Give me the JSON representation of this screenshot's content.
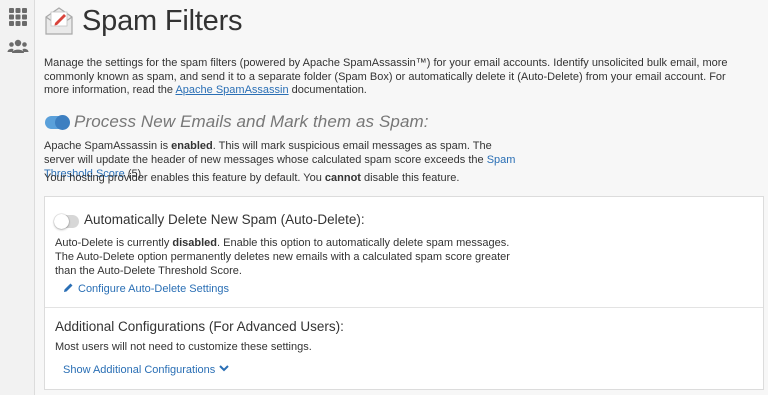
{
  "page": {
    "title": "Spam Filters"
  },
  "intro": {
    "text_before": "Manage the settings for the spam filters (powered by Apache SpamAssassin™) for your email accounts. Identify unsolicited bulk email, more commonly known as spam, and send it to a separate folder (Spam Box) or automatically delete it (Auto-Delete) from your email account. For more information, read the ",
    "link": "Apache SpamAssassin",
    "text_after": " documentation."
  },
  "process": {
    "toggle_state": "on",
    "heading": "Process New Emails and Mark them as Spam:",
    "line_a": "Apache SpamAssassin is ",
    "line_bold": "enabled",
    "line_b": ". This will mark suspicious email messages as spam. The server will update the header of new messages whose calculated spam score exceeds the ",
    "threshold_link": "Spam Threshold Score",
    "threshold_value": " (5).",
    "note_a": "Your hosting provider enables this feature by default. You ",
    "note_bold": "cannot",
    "note_b": " disable this feature."
  },
  "auto_delete": {
    "toggle_state": "off",
    "title": "Automatically Delete New Spam (Auto-Delete):",
    "text_a": "Auto-Delete is currently ",
    "text_bold": "disabled",
    "text_b": ". Enable this option to automatically delete spam messages. The Auto-Delete option permanently deletes new emails with a calculated spam score greater than the Auto-Delete Threshold Score.",
    "configure_link": "Configure Auto-Delete Settings"
  },
  "additional": {
    "title": "Additional Configurations (For Advanced Users):",
    "text": "Most users will not need to customize these settings.",
    "show_link": "Show Additional Configurations"
  },
  "colors": {
    "link": "#2a6fb5",
    "toggle_on": "#5aa0da",
    "toggle_off": "#d7d7d7"
  },
  "icons": {
    "nav_apps": "grid-icon",
    "nav_users": "users-icon",
    "page": "envelope-pen-icon",
    "configure": "pencil-icon",
    "show": "chevron-down-icon"
  }
}
